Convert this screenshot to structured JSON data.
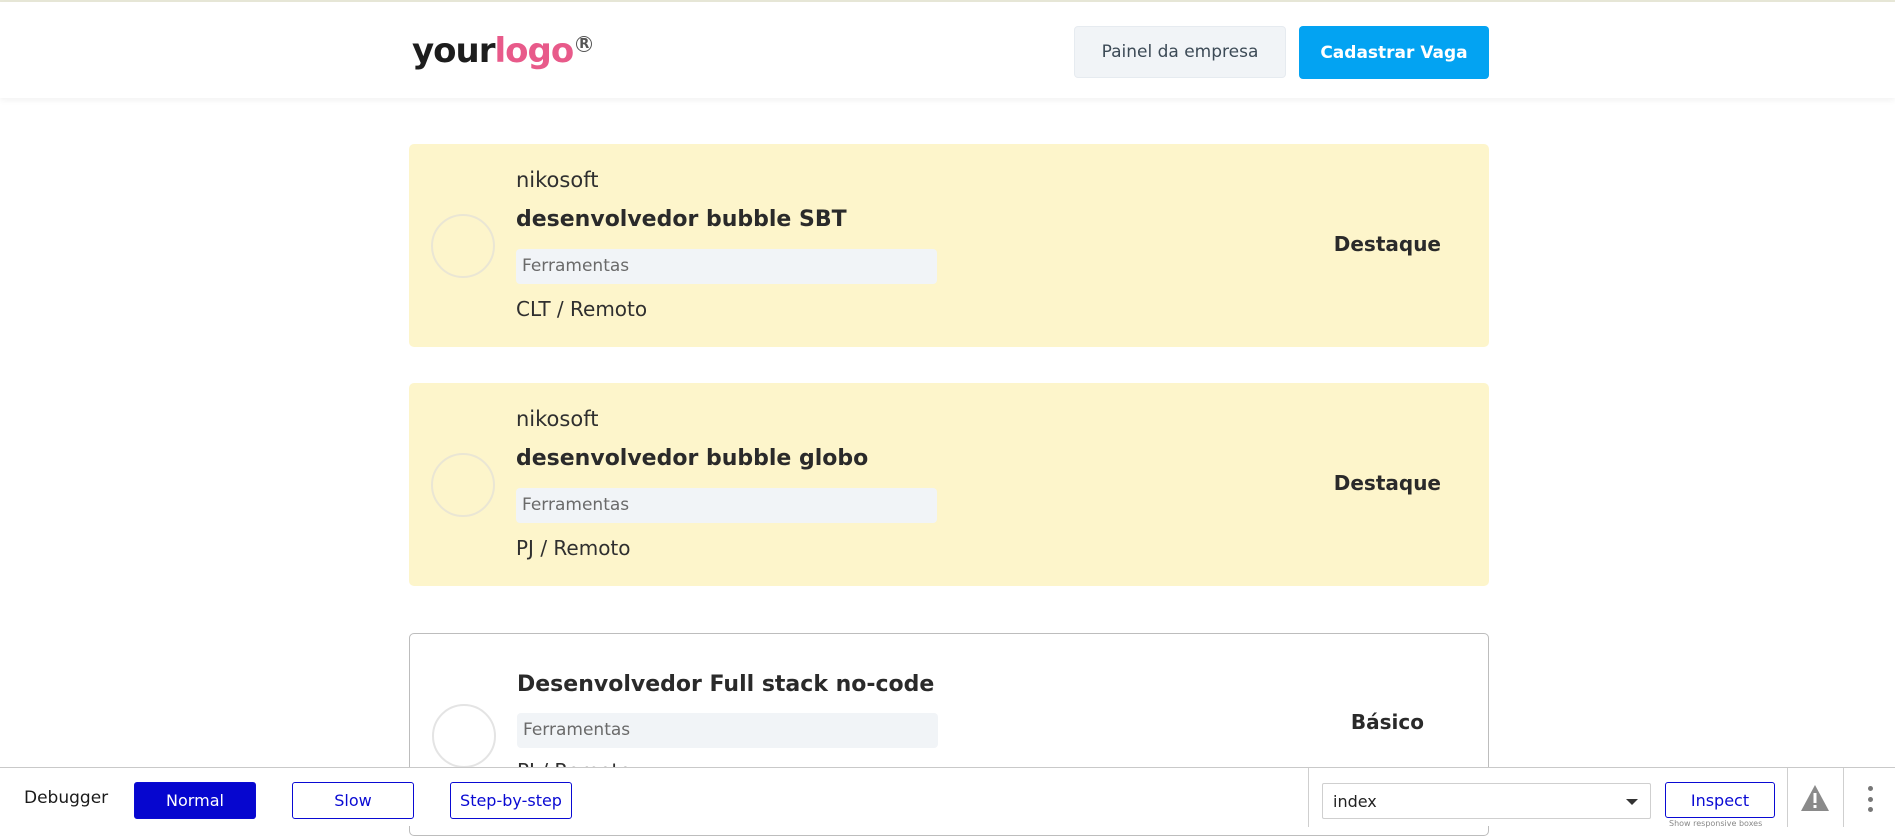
{
  "header": {
    "logo_your": "your",
    "logo_logo": "logo",
    "painel_label": "Painel da empresa",
    "cadastrar_label": "Cadastrar Vaga"
  },
  "jobs": [
    {
      "company": "nikosoft",
      "title": "desenvolvedor bubble SBT",
      "tools": "Ferramentas",
      "regime": "CLT / Remoto",
      "badge": "Destaque"
    },
    {
      "company": "nikosoft",
      "title": "desenvolvedor bubble globo",
      "tools": "Ferramentas",
      "regime": "PJ / Remoto",
      "badge": "Destaque"
    },
    {
      "company": "",
      "title": "Desenvolvedor Full stack no-code",
      "tools": "Ferramentas",
      "regime": "PJ / Remoto",
      "badge": "Básico"
    }
  ],
  "debugger": {
    "label": "Debugger",
    "normal": "Normal",
    "slow": "Slow",
    "step": "Step-by-step",
    "page_select": "index",
    "inspect": "Inspect",
    "hint": "Show responsive boxes"
  },
  "colors": {
    "accent": "#03a3f2",
    "featured_bg": "#fdf5cb",
    "logo_pink": "#e85a8a",
    "debugger_blue": "#0606cf"
  },
  "icons": {
    "warning": "warning-icon",
    "menu": "more-vertical-icon",
    "caret": "chevron-down-icon"
  }
}
